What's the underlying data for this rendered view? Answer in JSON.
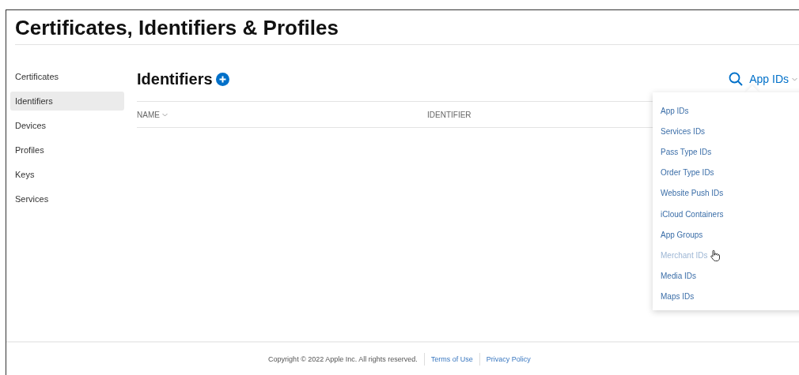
{
  "page_title": "Certificates, Identifiers & Profiles",
  "sidebar": {
    "items": [
      {
        "label": "Certificates",
        "selected": false
      },
      {
        "label": "Identifiers",
        "selected": true
      },
      {
        "label": "Devices",
        "selected": false
      },
      {
        "label": "Profiles",
        "selected": false
      },
      {
        "label": "Keys",
        "selected": false
      },
      {
        "label": "Services",
        "selected": false
      }
    ]
  },
  "content": {
    "title": "Identifiers",
    "filter": {
      "label": "App IDs",
      "expanded": true
    },
    "table": {
      "columns": [
        {
          "label": "NAME",
          "sortable": true
        },
        {
          "label": "IDENTIFIER",
          "sortable": false
        }
      ]
    }
  },
  "dropdown": {
    "items": [
      {
        "label": "App IDs",
        "hovered": false
      },
      {
        "label": "Services IDs",
        "hovered": false
      },
      {
        "label": "Pass Type IDs",
        "hovered": false
      },
      {
        "label": "Order Type IDs",
        "hovered": false
      },
      {
        "label": "Website Push IDs",
        "hovered": false
      },
      {
        "label": "iCloud Containers",
        "hovered": false
      },
      {
        "label": "App Groups",
        "hovered": false
      },
      {
        "label": "Merchant IDs",
        "hovered": true
      },
      {
        "label": "Media IDs",
        "hovered": false
      },
      {
        "label": "Maps IDs",
        "hovered": false
      }
    ]
  },
  "footer": {
    "copyright": "Copyright © 2022 Apple Inc. All rights reserved.",
    "links": [
      "Terms of Use",
      "Privacy Policy"
    ]
  }
}
